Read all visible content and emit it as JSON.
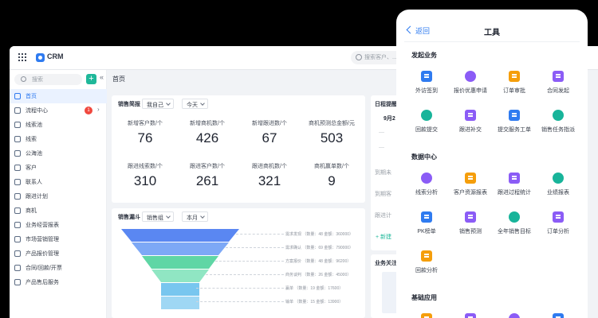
{
  "app": {
    "name": "CRM"
  },
  "header": {
    "search_placeholder": "搜索客户、..."
  },
  "sidebar": {
    "search_placeholder": "搜索",
    "add_label": "+",
    "collapse_label": "«",
    "items": [
      {
        "label": "首页",
        "active": true
      },
      {
        "label": "流程中心",
        "badge": "1",
        "has_children": true
      },
      {
        "label": "线索池"
      },
      {
        "label": "线索"
      },
      {
        "label": "公海池"
      },
      {
        "label": "客户"
      },
      {
        "label": "联系人"
      },
      {
        "label": "跟进计划"
      },
      {
        "label": "商机"
      },
      {
        "label": "业务经营报表"
      },
      {
        "label": "市场营销管理"
      },
      {
        "label": "产品报价管理"
      },
      {
        "label": "合同/回款/开票"
      },
      {
        "label": "产品售后服务"
      }
    ]
  },
  "main": {
    "page_title": "首页",
    "sales_brief": {
      "title": "销售简报",
      "owner_select": "我自己",
      "period_select": "今天",
      "stats": [
        {
          "label": "新增客户数/个",
          "value": "76"
        },
        {
          "label": "新增商机数/个",
          "value": "426"
        },
        {
          "label": "新增跟进数/个",
          "value": "67"
        },
        {
          "label": "商机预测总金额/元",
          "value": "503"
        },
        {
          "label": "跟进线索数/个",
          "value": "310"
        },
        {
          "label": "跟进客户数/个",
          "value": "261"
        },
        {
          "label": "跟进商机数/个",
          "value": "321"
        },
        {
          "label": "商机赢单数/个",
          "value": "9"
        }
      ]
    },
    "funnel": {
      "title": "销售漏斗",
      "group_select": "销售组",
      "period_select": "本月",
      "stages": [
        {
          "label": "需求发现 （数量：48 金额：360000）",
          "color": "#5a87f2"
        },
        {
          "label": "需求确认 （数量：69 金额：790000）",
          "color": "#7da8f6"
        },
        {
          "label": "方案报价 （数量：48 金额：96200）",
          "color": "#5fd6a5"
        },
        {
          "label": "商务谈判 （数量：26 金额：45000）",
          "color": "#90e6c3"
        },
        {
          "label": "赢单 （数量：19 金额：17600）",
          "color": "#78c6ef"
        },
        {
          "label": "输单 （数量：15 金额：13900）",
          "color": "#9fd7f4"
        }
      ]
    },
    "schedule": {
      "title": "日程提醒",
      "date": "9月2",
      "items": [
        "到期未",
        "到期客",
        "跟进计"
      ],
      "new_label": "+ 新建"
    },
    "follow": {
      "title": "业务关注"
    }
  },
  "phone": {
    "back_label": "返回",
    "title": "工具",
    "sections": [
      {
        "title": "发起业务",
        "tiles": [
          {
            "label": "外访签到",
            "icon": "doc-icon",
            "color": "#2f7bf0"
          },
          {
            "label": "报价优惠申请",
            "icon": "ticket-icon",
            "color": "#8b5cf6"
          },
          {
            "label": "订单审批",
            "icon": "stamp-icon",
            "color": "#f59e0b"
          },
          {
            "label": "合同发起",
            "icon": "tag-icon",
            "color": "#8b5cf6"
          },
          {
            "label": "回款提交",
            "icon": "money-icon",
            "color": "#18b49a"
          },
          {
            "label": "跟进补交",
            "icon": "doc-icon",
            "color": "#8b5cf6"
          },
          {
            "label": "提交服务工单",
            "icon": "service-icon",
            "color": "#2f7bf0"
          },
          {
            "label": "销售任务指派",
            "icon": "task-icon",
            "color": "#18b49a"
          }
        ]
      },
      {
        "title": "数据中心",
        "tiles": [
          {
            "label": "线索分析",
            "icon": "flow-icon",
            "color": "#8b5cf6"
          },
          {
            "label": "客户资源报表",
            "icon": "user-icon",
            "color": "#f59e0b"
          },
          {
            "label": "跟进过程统计",
            "icon": "monitor-icon",
            "color": "#8b5cf6"
          },
          {
            "label": "业绩报表",
            "icon": "report-icon",
            "color": "#18b49a"
          },
          {
            "label": "PK榜单",
            "icon": "bar-chart-icon",
            "color": "#2f7bf0"
          },
          {
            "label": "销售预测",
            "icon": "pie-chart-icon",
            "color": "#8b5cf6"
          },
          {
            "label": "全年销售目标",
            "icon": "target-icon",
            "color": "#18b49a"
          },
          {
            "label": "订单分析",
            "icon": "cart-icon",
            "color": "#8b5cf6"
          },
          {
            "label": "回款分析",
            "icon": "alarm-icon",
            "color": "#f59e0b"
          }
        ]
      },
      {
        "title": "基础应用",
        "tiles": [
          {
            "label": "",
            "icon": "app-icon",
            "color": "#f59e0b"
          },
          {
            "label": "",
            "icon": "app-icon",
            "color": "#8b5cf6"
          },
          {
            "label": "",
            "icon": "app-icon",
            "color": "#8b5cf6"
          },
          {
            "label": "",
            "icon": "app-icon",
            "color": "#2f7bf0"
          }
        ]
      }
    ]
  }
}
